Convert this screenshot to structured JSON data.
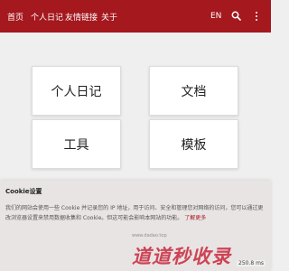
{
  "nav": {
    "items": [
      "首页",
      "个人日记",
      "友情链接",
      "关于"
    ],
    "lang": "EN",
    "search_icon": "search-icon",
    "menu_icon": "menu-icon"
  },
  "tiles": [
    {
      "label": "个人日记"
    },
    {
      "label": "文档"
    },
    {
      "label": "工具"
    },
    {
      "label": "模板"
    }
  ],
  "cookie": {
    "title": "Cookie设置",
    "text_line1": "我们的网站会使用一些 Cookie 并记录您的 IP 地址，用于访问、安全和管理您对网络的访问，您可以通过更",
    "text_line2": "改浏览器设置来禁用数据收集和 Cookie。但这可能会影响本网站的功能。",
    "link": "了解更多"
  },
  "watermark": {
    "text": "道道秒收录",
    "sub": "www.dadao.top"
  },
  "timer": "250.8 ms",
  "colors": {
    "brand": "#a4181e",
    "background": "#f0efef",
    "cookie_bg": "#e9e4e4"
  }
}
